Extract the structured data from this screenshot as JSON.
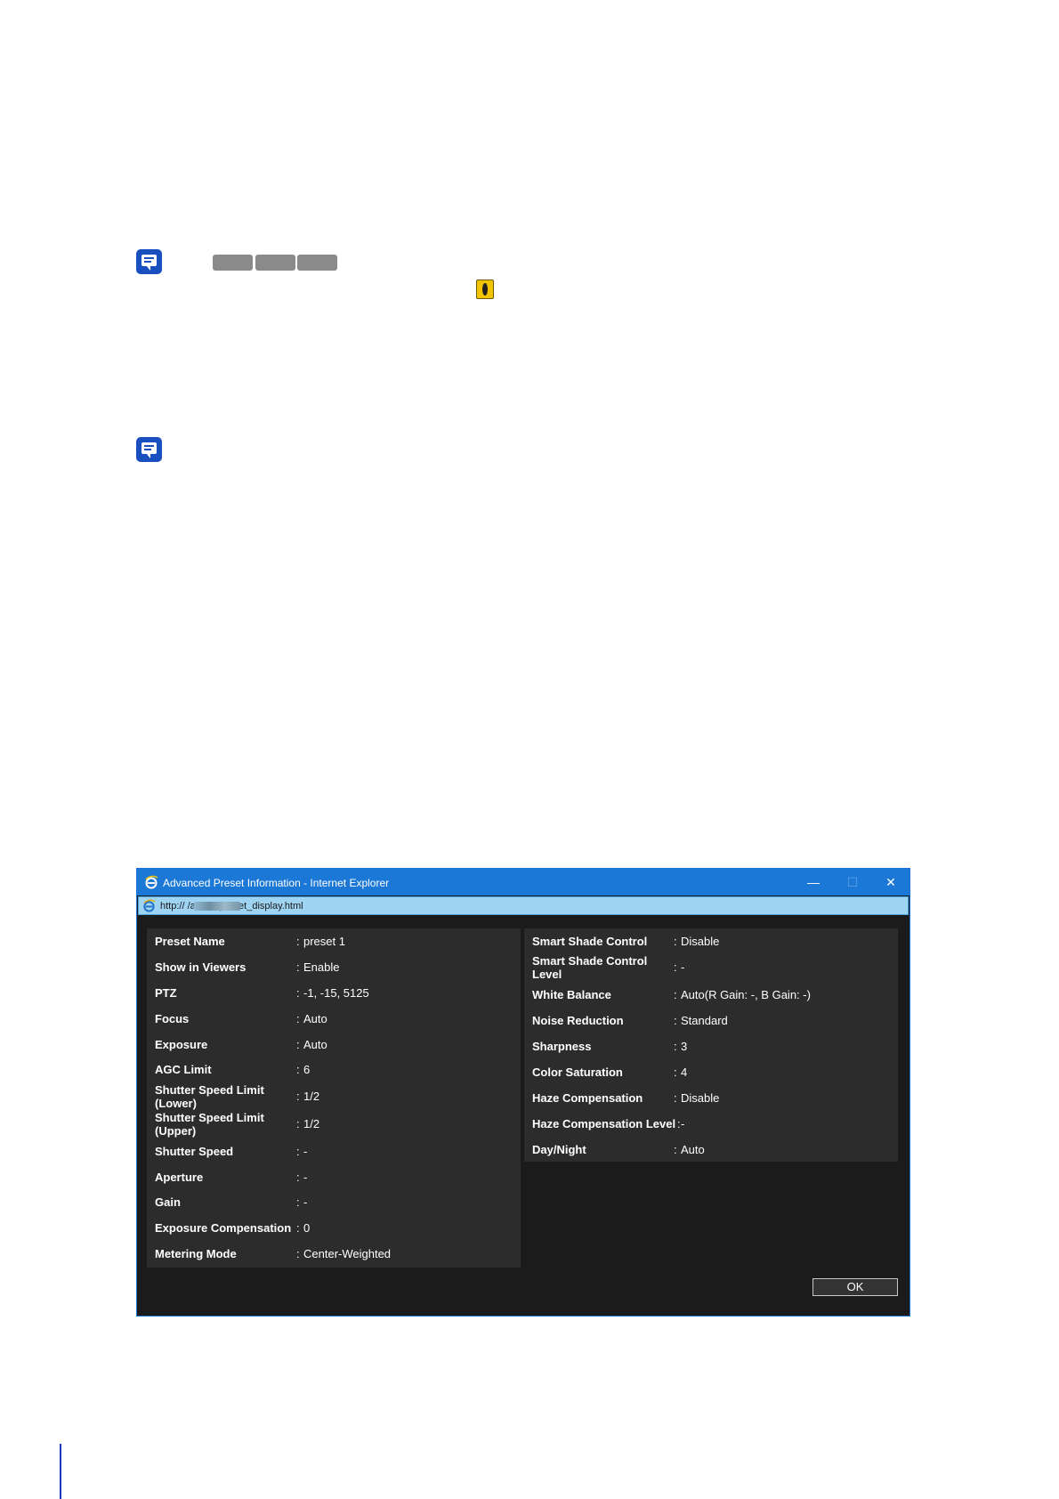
{
  "dialog": {
    "title": "Advanced Preset Information - Internet Explorer",
    "url": "http://           /admin/preset_display.html",
    "minimize_glyph": "—",
    "maximize_glyph": "☐",
    "close_glyph": "✕",
    "ok_label": "OK"
  },
  "left_panel": [
    {
      "label": "Preset Name",
      "value": "preset 1"
    },
    {
      "label": "Show in Viewers",
      "value": "Enable"
    },
    {
      "label": "PTZ",
      "value": "-1, -15, 5125"
    },
    {
      "label": "Focus",
      "value": "Auto"
    },
    {
      "label": "Exposure",
      "value": "Auto"
    },
    {
      "label": "AGC Limit",
      "value": "6"
    },
    {
      "label": "Shutter Speed Limit (Lower)",
      "value": "1/2"
    },
    {
      "label": "Shutter Speed Limit (Upper)",
      "value": "1/2"
    },
    {
      "label": "Shutter Speed",
      "value": "-"
    },
    {
      "label": "Aperture",
      "value": "-"
    },
    {
      "label": "Gain",
      "value": "-"
    },
    {
      "label": "Exposure Compensation",
      "value": "0"
    },
    {
      "label": "Metering Mode",
      "value": "Center-Weighted"
    }
  ],
  "right_panel": [
    {
      "label": "Smart Shade Control",
      "value": "Disable"
    },
    {
      "label": "Smart Shade Control Level",
      "value": "-"
    },
    {
      "label": "White Balance",
      "value": "Auto(R Gain: -, B Gain: -)"
    },
    {
      "label": "Noise Reduction",
      "value": "Standard"
    },
    {
      "label": "Sharpness",
      "value": "3"
    },
    {
      "label": "Color Saturation",
      "value": "4"
    },
    {
      "label": "Haze Compensation",
      "value": "Disable"
    },
    {
      "label": "Haze Compensation Level",
      "value": "-"
    },
    {
      "label": "Day/Night",
      "value": "Auto"
    }
  ],
  "colon": ":",
  "icons": [
    "note-icon",
    "warning-icon",
    "ie-icon"
  ]
}
